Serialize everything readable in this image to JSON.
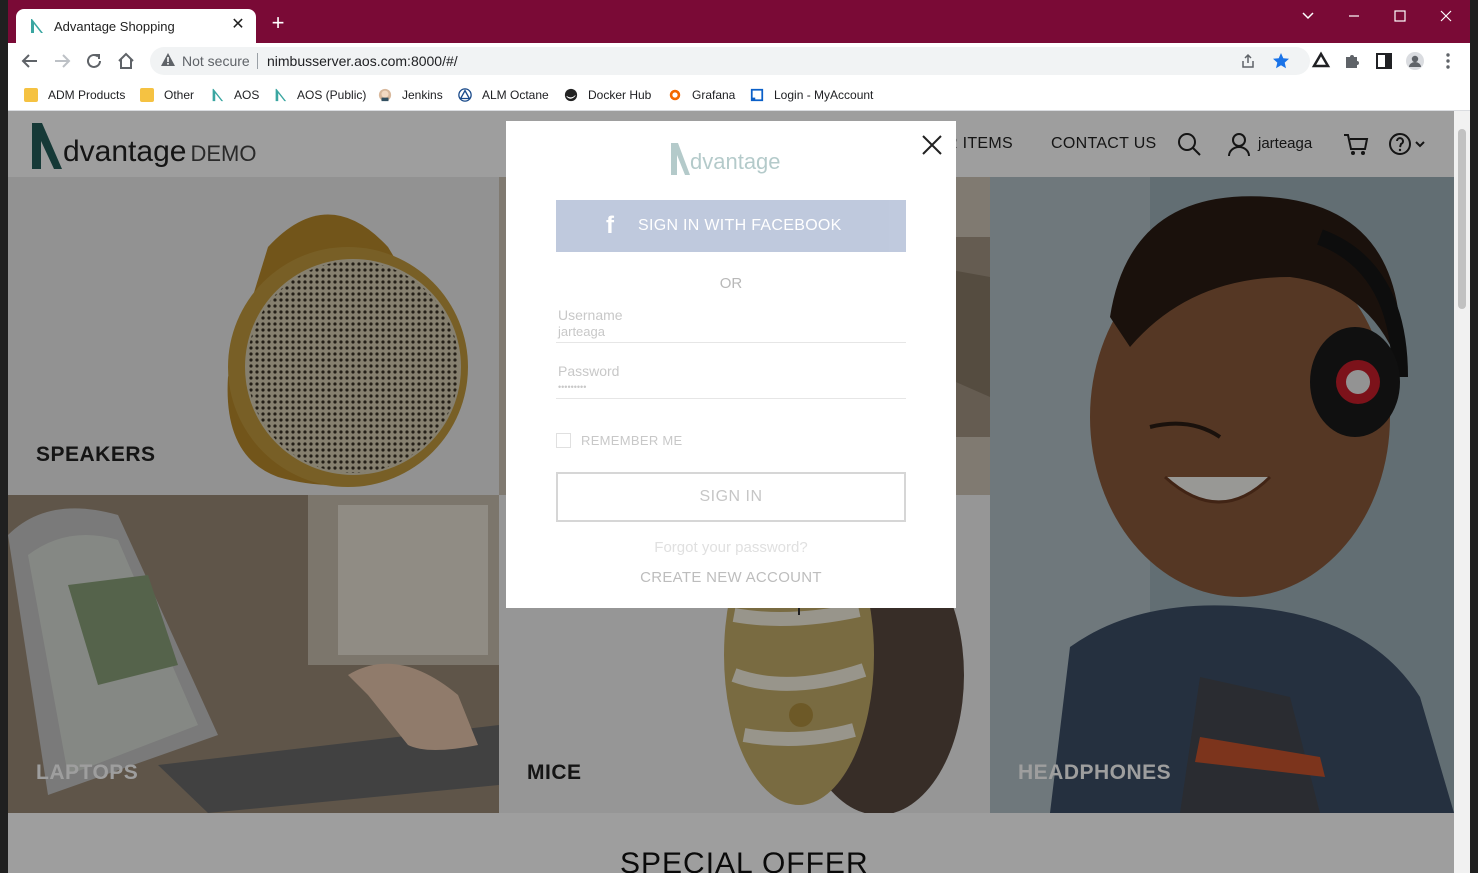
{
  "browser": {
    "tab_title": "Advantage Shopping",
    "tab_close": "✕",
    "new_tab": "+",
    "not_secure": "Not secure",
    "url": "nimbusserver.aos.com:8000/#/",
    "accent_color": "#7a0a36"
  },
  "bookmarks": [
    {
      "label": "ADM Products",
      "icon": "folder-icon"
    },
    {
      "label": "Other",
      "icon": "folder-icon"
    },
    {
      "label": "AOS",
      "icon": "advantage-icon"
    },
    {
      "label": "AOS (Public)",
      "icon": "advantage-icon"
    },
    {
      "label": "Jenkins",
      "icon": "jenkins-icon"
    },
    {
      "label": "ALM Octane",
      "icon": "octane-icon"
    },
    {
      "label": "Docker Hub",
      "icon": "docker-icon"
    },
    {
      "label": "Grafana",
      "icon": "grafana-icon"
    },
    {
      "label": "Login - MyAccount",
      "icon": "myaccount-icon"
    }
  ],
  "site": {
    "logo_word": "dvantage",
    "logo_demo": "DEMO",
    "nav_items_partial": "R ITEMS",
    "nav_contact": "CONTACT US",
    "username": "jarteaga",
    "categories": [
      "SPEAKERS",
      "LAPTOPS",
      "MICE",
      "HEADPHONES"
    ],
    "special_offer": "SPECIAL OFFER"
  },
  "login_modal": {
    "logo_word": "dvantage",
    "facebook_button": "SIGN IN WITH FACEBOOK",
    "or": "OR",
    "username_label": "Username",
    "username_value": "jarteaga",
    "password_label": "Password",
    "password_value": "•••••••••",
    "remember_me": "REMEMBER ME",
    "sign_in": "SIGN IN",
    "forgot": "Forgot your password?",
    "create_account": "CREATE NEW ACCOUNT"
  }
}
